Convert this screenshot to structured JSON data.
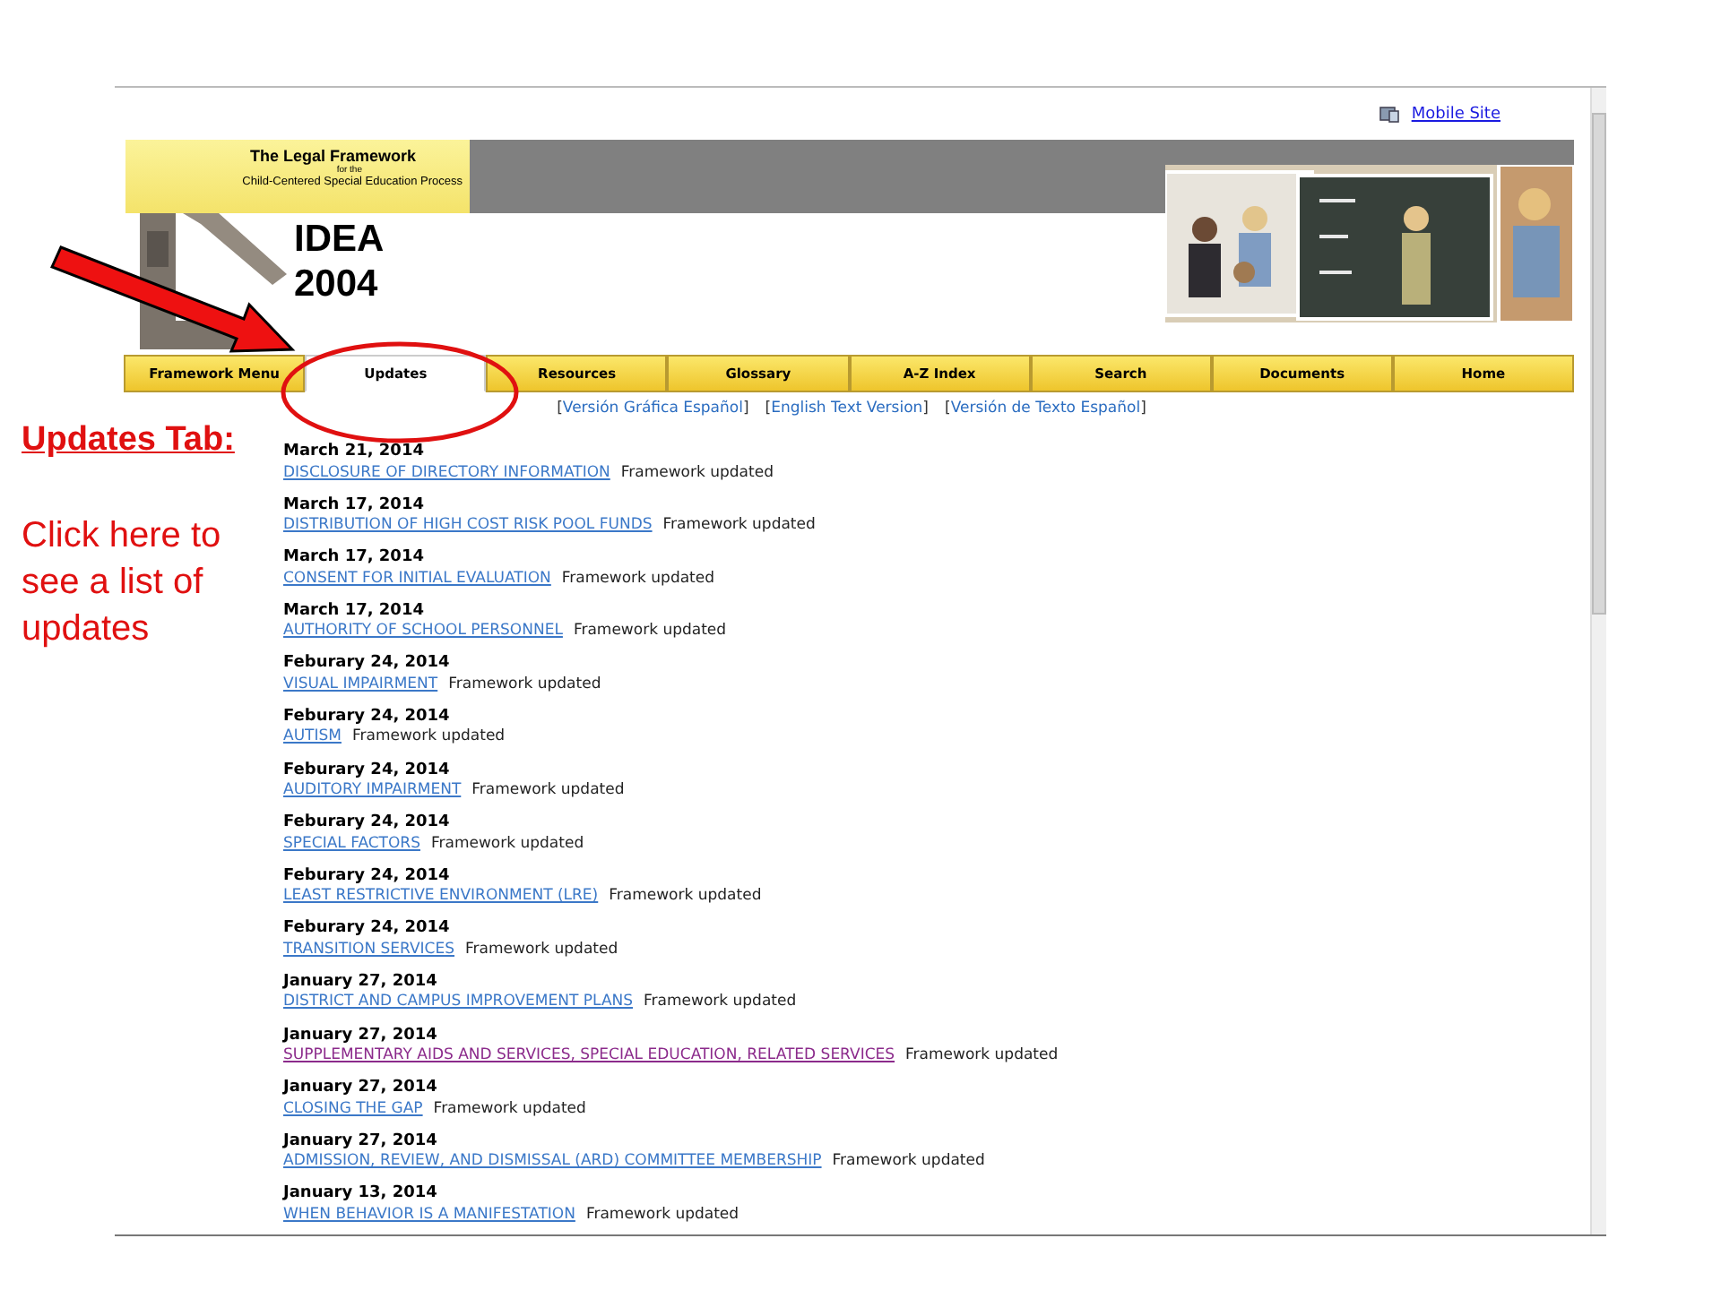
{
  "screenshot": {
    "mobile_link": "Mobile Site",
    "logo": {
      "title": "The Legal Framework",
      "subtitle": "for the",
      "process": "Child-Centered Special Education Process"
    },
    "heading_lines": [
      "IDEA",
      "2004"
    ],
    "tabs": [
      {
        "label": "Framework Menu",
        "selected": false
      },
      {
        "label": "Updates",
        "selected": true
      },
      {
        "label": "Resources",
        "selected": false
      },
      {
        "label": "Glossary",
        "selected": false
      },
      {
        "label": "A-Z Index",
        "selected": false
      },
      {
        "label": "Search",
        "selected": false
      },
      {
        "label": "Documents",
        "selected": false
      },
      {
        "label": "Home",
        "selected": false
      }
    ],
    "language_links": [
      {
        "open": "[",
        "label": "Versión Gráfica Español",
        "close": "]"
      },
      {
        "open": "[",
        "label": "English Text Version",
        "close": "]"
      },
      {
        "open": "[",
        "label": "Versión de Texto Español",
        "close": "]"
      }
    ],
    "updates": [
      {
        "date": "March 21, 2014",
        "title": "DISCLOSURE OF DIRECTORY INFORMATION",
        "status": "Framework updated",
        "visited": false
      },
      {
        "date": "March 17, 2014",
        "title": "DISTRIBUTION OF HIGH COST RISK POOL FUNDS",
        "status": "Framework updated",
        "visited": false
      },
      {
        "date": "March 17, 2014",
        "title": "CONSENT FOR INITIAL EVALUATION",
        "status": "Framework updated",
        "visited": false
      },
      {
        "date": "March 17, 2014",
        "title": "AUTHORITY OF SCHOOL PERSONNEL",
        "status": "Framework updated",
        "visited": false
      },
      {
        "date": "Feburary 24, 2014",
        "title": "VISUAL IMPAIRMENT",
        "status": "Framework updated",
        "visited": false
      },
      {
        "date": "Feburary 24, 2014",
        "title": "AUTISM",
        "status": "Framework updated",
        "visited": false
      },
      {
        "date": "Feburary 24, 2014",
        "title": "AUDITORY IMPAIRMENT",
        "status": "Framework updated",
        "visited": false
      },
      {
        "date": "Feburary 24, 2014",
        "title": "SPECIAL FACTORS",
        "status": "Framework updated",
        "visited": false
      },
      {
        "date": "Feburary 24, 2014",
        "title": "LEAST RESTRICTIVE ENVIRONMENT (LRE)",
        "status": "Framework updated",
        "visited": false
      },
      {
        "date": "Feburary 24, 2014",
        "title": "TRANSITION SERVICES",
        "status": "Framework updated",
        "visited": false
      },
      {
        "date": "January 27, 2014",
        "title": "DISTRICT AND CAMPUS IMPROVEMENT PLANS",
        "status": "Framework updated",
        "visited": false
      },
      {
        "date": "January 27, 2014",
        "title": "SUPPLEMENTARY AIDS AND SERVICES, SPECIAL EDUCATION, RELATED SERVICES",
        "status": "Framework updated",
        "visited": true
      },
      {
        "date": "January 27, 2014",
        "title": "CLOSING THE GAP",
        "status": "Framework updated",
        "visited": false
      },
      {
        "date": "January 27, 2014",
        "title": "ADMISSION, REVIEW, AND DISMISSAL (ARD) COMMITTEE MEMBERSHIP",
        "status": "Framework updated",
        "visited": false
      },
      {
        "date": "January 13, 2014",
        "title": "WHEN BEHAVIOR IS A MANIFESTATION",
        "status": "Framework updated",
        "visited": false
      }
    ]
  },
  "annotation": {
    "title": "Updates Tab:",
    "text": "Click here to see a list of updates"
  }
}
